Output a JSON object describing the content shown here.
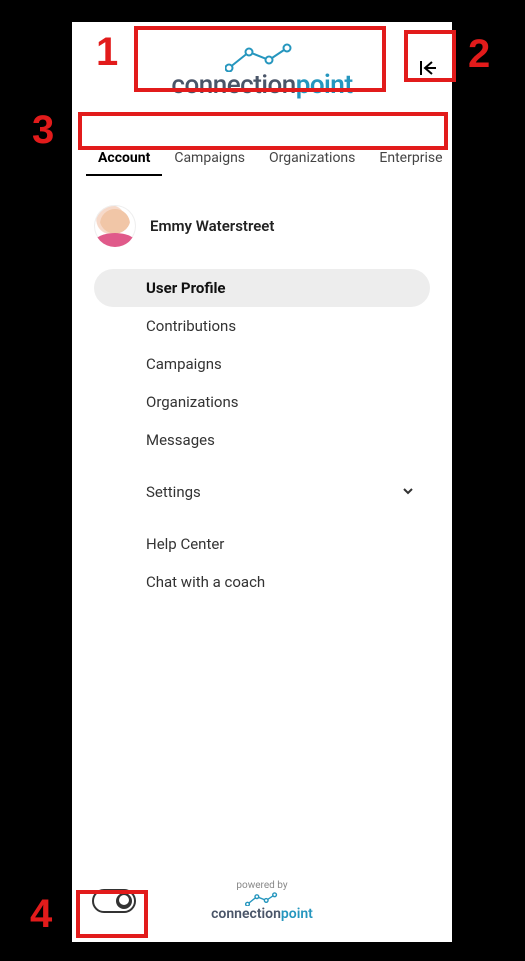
{
  "header": {
    "brand_part1": "connection",
    "brand_part2": "point",
    "collapse_label": "Collapse sidebar"
  },
  "tabs": [
    {
      "label": "Account",
      "active": true
    },
    {
      "label": "Campaigns",
      "active": false
    },
    {
      "label": "Organizations",
      "active": false
    },
    {
      "label": "Enterprise",
      "active": false
    }
  ],
  "user": {
    "name": "Emmy Waterstreet"
  },
  "nav": [
    {
      "label": "User Profile",
      "active": true
    },
    {
      "label": "Contributions"
    },
    {
      "label": "Campaigns"
    },
    {
      "label": "Organizations"
    },
    {
      "label": "Messages"
    },
    {
      "spacer": true
    },
    {
      "label": "Settings",
      "expandable": true
    },
    {
      "spacer": true
    },
    {
      "label": "Help Center"
    },
    {
      "label": "Chat with a coach"
    }
  ],
  "footer": {
    "powered_by": "powered by",
    "brand_part1": "connection",
    "brand_part2": "point"
  },
  "annotations": {
    "n1": "1",
    "n2": "2",
    "n3": "3",
    "n4": "4"
  }
}
